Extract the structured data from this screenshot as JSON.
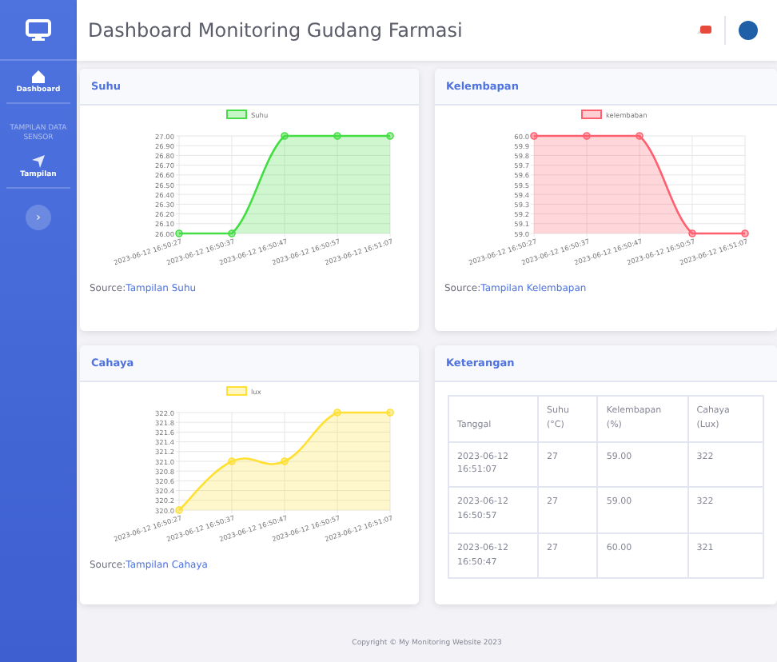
{
  "header": {
    "title": "Dashboard Monitoring Gudang Farmasi"
  },
  "sidebar": {
    "sections": [
      {
        "items": [
          {
            "label": "Dashboard"
          }
        ]
      },
      {
        "heading": "TAMPILAN DATA SENSOR",
        "items": [
          {
            "label": "Tampilan"
          }
        ]
      }
    ],
    "toggle": "›"
  },
  "cards": [
    {
      "title": "Suhu",
      "source_label": "Source:",
      "source_link": "Tampilan Suhu",
      "chart_data": {
        "type": "area",
        "grid": true,
        "categories": [
          "2023-06-12 16:50:27",
          "2023-06-12 16:50:37",
          "2023-06-12 16:50:47",
          "2023-06-12 16:50:57",
          "2023-06-12 16:51:07"
        ],
        "series": [
          {
            "name": "Suhu",
            "color": "#44dd44",
            "values": [
              26,
              26,
              27,
              27,
              27
            ]
          }
        ],
        "ylim": [
          26,
          27
        ],
        "yticks": [
          {
            "value": 26,
            "label": "26.00"
          },
          {
            "value": 26.1,
            "label": "26.10"
          },
          {
            "value": 26.2,
            "label": "26.20"
          },
          {
            "value": 26.3,
            "label": "26.30"
          },
          {
            "value": 26.4,
            "label": "26.40"
          },
          {
            "value": 26.5,
            "label": "26.50"
          },
          {
            "value": 26.6,
            "label": "26.60"
          },
          {
            "value": 26.7,
            "label": "26.70"
          },
          {
            "value": 26.8,
            "label": "26.80"
          },
          {
            "value": 26.9,
            "label": "26.90"
          },
          {
            "value": 27,
            "label": "27.00"
          }
        ]
      }
    },
    {
      "title": "Kelembapan",
      "source_label": "Source:",
      "source_link": "Tampilan Kelembapan",
      "chart_data": {
        "type": "area",
        "grid": true,
        "categories": [
          "2023-06-12 16:50:27",
          "2023-06-12 16:50:37",
          "2023-06-12 16:50:47",
          "2023-06-12 16:50:57",
          "2023-06-12 16:51:07"
        ],
        "series": [
          {
            "name": "kelembaban",
            "color": "#ff6070",
            "values": [
              60,
              60,
              60,
              59,
              59
            ]
          }
        ],
        "ylim": [
          59,
          60
        ],
        "yticks": [
          {
            "value": 59,
            "label": "59.0"
          },
          {
            "value": 59.1,
            "label": "59.1"
          },
          {
            "value": 59.2,
            "label": "59.2"
          },
          {
            "value": 59.3,
            "label": "59.3"
          },
          {
            "value": 59.4,
            "label": "59.4"
          },
          {
            "value": 59.5,
            "label": "59.5"
          },
          {
            "value": 59.6,
            "label": "59.6"
          },
          {
            "value": 59.7,
            "label": "59.7"
          },
          {
            "value": 59.8,
            "label": "59.8"
          },
          {
            "value": 59.9,
            "label": "59.9"
          },
          {
            "value": 60,
            "label": "60.0"
          }
        ]
      }
    },
    {
      "title": "Cahaya",
      "source_label": "Source:",
      "source_link": "Tampilan Cahaya",
      "chart_data": {
        "type": "area",
        "grid": true,
        "categories": [
          "2023-06-12 16:50:27",
          "2023-06-12 16:50:37",
          "2023-06-12 16:50:47",
          "2023-06-12 16:50:57",
          "2023-06-12 16:51:07"
        ],
        "series": [
          {
            "name": "lux",
            "color": "#ffe033",
            "values": [
              320,
              321,
              321,
              322,
              322
            ]
          }
        ],
        "ylim": [
          320,
          322
        ],
        "yticks": [
          {
            "value": 320,
            "label": "320.0"
          },
          {
            "value": 320.2,
            "label": "320.2"
          },
          {
            "value": 320.4,
            "label": "320.4"
          },
          {
            "value": 320.6,
            "label": "320.6"
          },
          {
            "value": 320.8,
            "label": "320.8"
          },
          {
            "value": 321,
            "label": "321.0"
          },
          {
            "value": 321.2,
            "label": "321.2"
          },
          {
            "value": 321.4,
            "label": "321.4"
          },
          {
            "value": 321.6,
            "label": "321.6"
          },
          {
            "value": 321.8,
            "label": "321.8"
          },
          {
            "value": 322,
            "label": "322.0"
          }
        ]
      }
    }
  ],
  "table_card": {
    "title": "Keterangan",
    "columns": [
      "Tanggal",
      "Suhu (°C)",
      "Kelembapan (%)",
      "Cahaya (Lux)"
    ],
    "rows": [
      [
        "2023-06-12 16:51:07",
        "27",
        "59.00",
        "322"
      ],
      [
        "2023-06-12 16:50:57",
        "27",
        "59.00",
        "322"
      ],
      [
        "2023-06-12 16:50:47",
        "27",
        "60.00",
        "321"
      ]
    ]
  },
  "footer": "Copyright © My Monitoring Website 2023"
}
